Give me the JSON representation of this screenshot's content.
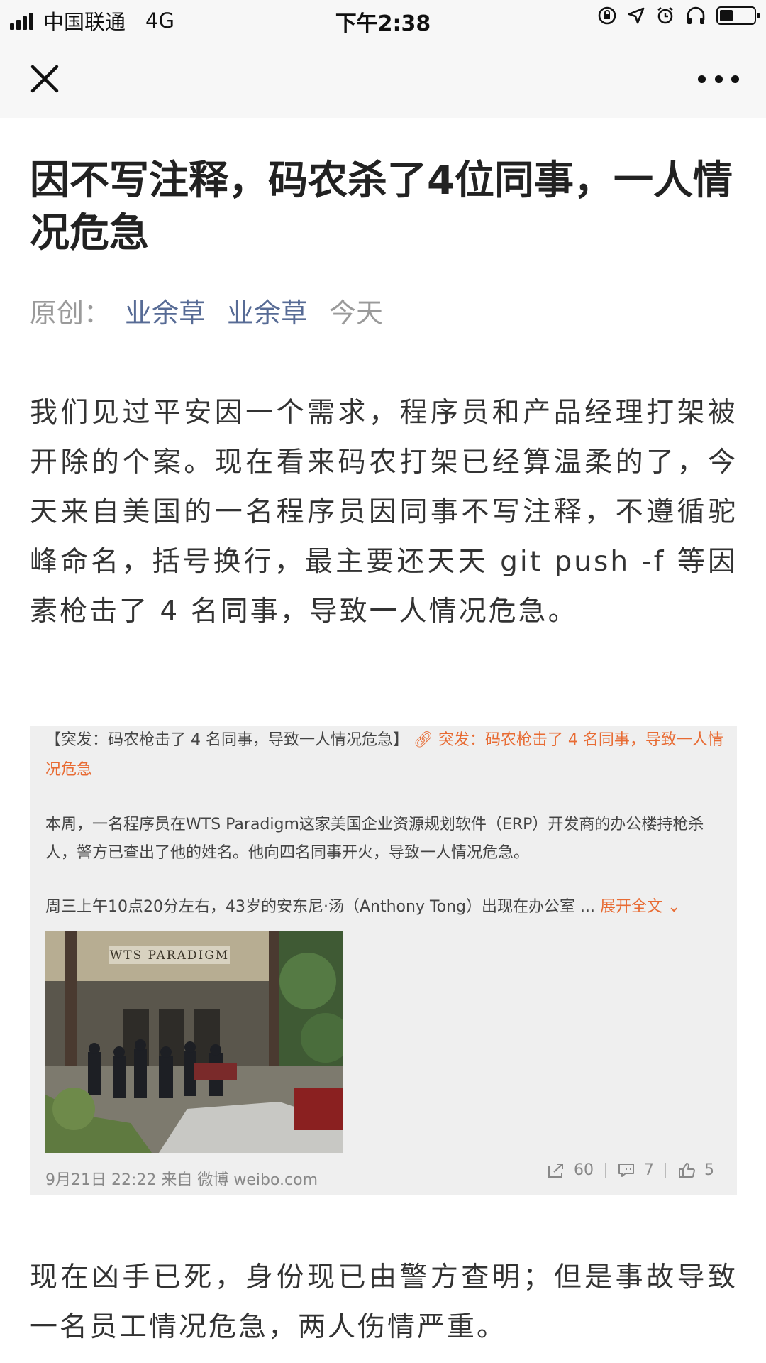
{
  "status_bar": {
    "carrier": "中国联通",
    "network": "4G",
    "time": "下午2:38"
  },
  "nav": {
    "close_icon": "close-icon",
    "more_icon": "more-icon"
  },
  "article": {
    "title": "因不写注释，码农杀了4位同事，一人情况危急",
    "meta_label": "原创：",
    "author": "业余草",
    "account": "业余草",
    "date": "今天",
    "paragraph1": "我们见过平安因一个需求，程序员和产品经理打架被开除的个案。现在看来码农打架已经算温柔的了，今天来自美国的一名程序员因同事不写注释，不遵循驼峰命名，括号换行，最主要还天天 git push -f 等因素枪击了 4 名同事，导致一人情况危急。",
    "paragraph2": "现在凶手已死，身份现已由警方查明；但是事故导致一名员工情况危急，两人伤情严重。"
  },
  "weibo_card": {
    "headline_prefix": "【突发：码农枪击了 4 名同事，导致一人情况危急】",
    "headline_link": "突发：码农枪击了 4 名同事，导致一人情况危急",
    "body1": "本周，一名程序员在WTS Paradigm这家美国企业资源规划软件（ERP）开发商的办公楼持枪杀人，警方已查出了他的姓名。他向四名同事开火，导致一人情况危急。",
    "body2": "周三上午10点20分左右，43岁的安东尼·汤（Anthony Tong）出现在办公室 ...",
    "expand_label": "展开全文",
    "photo_sign": "WTS PARADIGM",
    "footer": "9月21日 22:22 来自 微博 weibo.com",
    "shares": "60",
    "comments": "7",
    "likes": "5",
    "accent_color": "#e86b33"
  }
}
